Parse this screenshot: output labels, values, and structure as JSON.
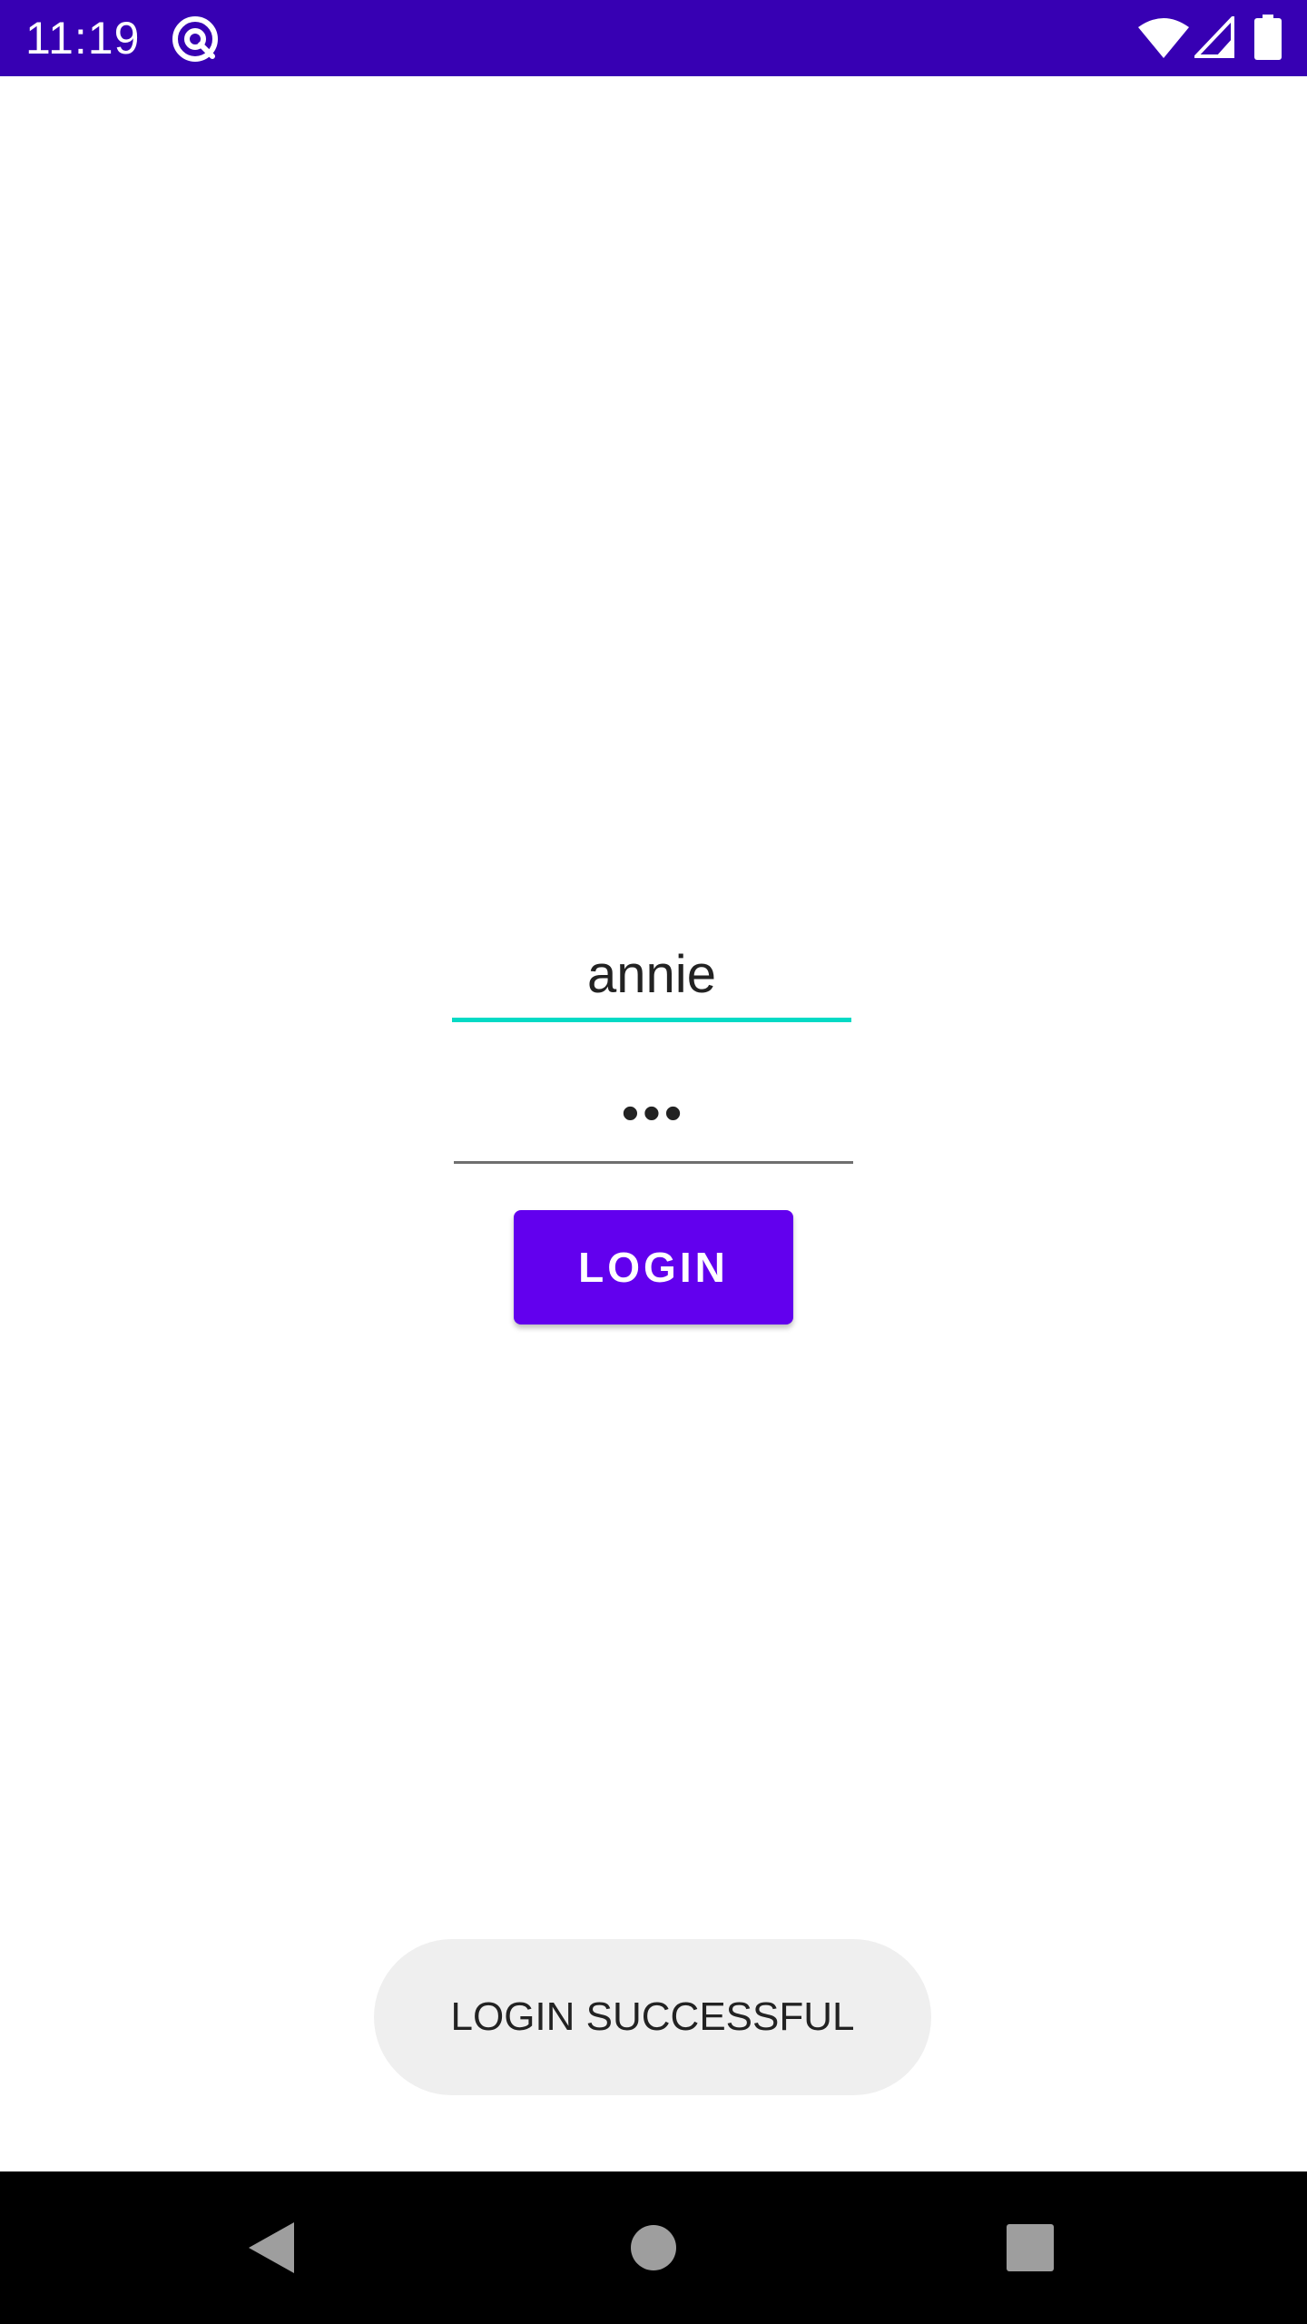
{
  "status_bar": {
    "time": "11:19",
    "app_icon": "at-sign-icon",
    "wifi_icon": "wifi-icon",
    "signal_icon": "cellular-signal-icon",
    "battery_icon": "battery-icon",
    "background_color": "#3700b3"
  },
  "login_form": {
    "username_value": "annie",
    "password_value": "•••",
    "login_label": "LOGIN",
    "button_color": "#6200ee",
    "focus_underline_color": "#03dac5"
  },
  "toast": {
    "message": "LOGIN SUCCESSFUL"
  },
  "nav_bar": {
    "back_icon": "back-triangle-icon",
    "home_icon": "home-circle-icon",
    "recents_icon": "recents-square-icon"
  }
}
